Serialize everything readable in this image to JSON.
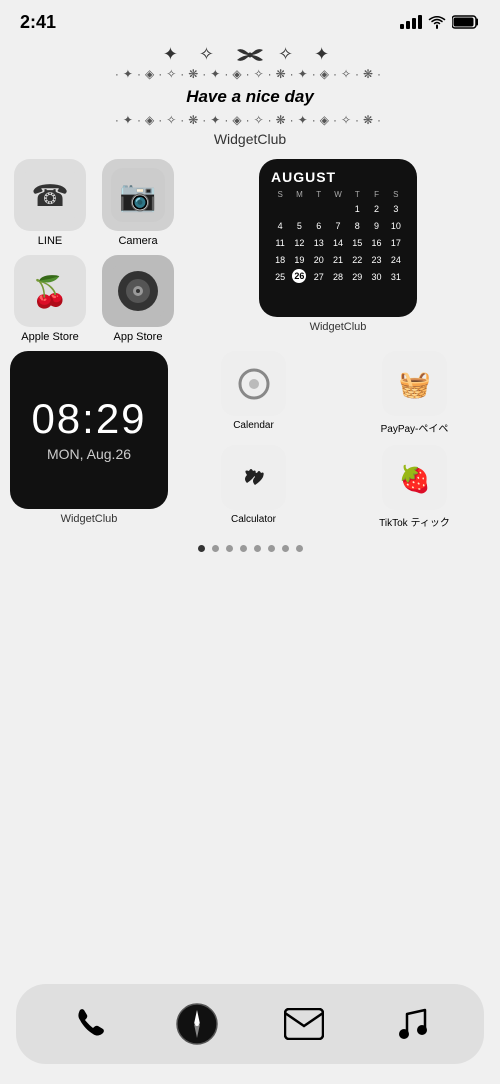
{
  "statusBar": {
    "time": "2:41",
    "battery": "full",
    "wifi": true,
    "signal": true
  },
  "decoration": {
    "bow": "✦ ✧ 𝓑 ✧ ✦",
    "sparkle1": "·✦·✧·❋·✦·✧·❋·✦·",
    "niceDay": "Have a nice day",
    "sparkle2": "·✦·✧·❋·✦·✧·❋·✦·",
    "widgetClubLabel": "WidgetClub"
  },
  "apps": {
    "row1": [
      {
        "name": "LINE",
        "emoji": "📞",
        "bg": "#ddd"
      },
      {
        "name": "Camera",
        "emoji": "📷",
        "bg": "#d5d5d5"
      }
    ],
    "row2": [
      {
        "name": "Apple Store",
        "emoji": "🍒",
        "bg": "#e0e0e0"
      },
      {
        "name": "App Store",
        "emoji": "💿",
        "bg": "#c5c5c5"
      }
    ],
    "calendarWidget": {
      "month": "AUGUST",
      "days": [
        "",
        "",
        "",
        "1",
        "2",
        "3",
        "4",
        "5",
        "6",
        "7",
        "8",
        "9",
        "10",
        "11",
        "12",
        "13",
        "14",
        "15",
        "16",
        "17",
        "18",
        "19",
        "20",
        "21",
        "22",
        "23",
        "24",
        "25",
        "26",
        "27",
        "28",
        "29",
        "30",
        "31"
      ],
      "today": "26",
      "label": "WidgetClub"
    }
  },
  "widgetRow": {
    "clockWidget": {
      "time": "08:29",
      "date": "MON, Aug.26",
      "label": "WidgetClub"
    },
    "smallIcons": [
      {
        "name": "Calendar",
        "emoji": "⭕",
        "bg": "#e8e8e8"
      },
      {
        "name": "PayPay-ペイペ",
        "emoji": "🧺",
        "bg": "#e8e8e8"
      },
      {
        "name": "Calculator",
        "emoji": "🖤",
        "bg": "#e8e8e8"
      },
      {
        "name": "TikTok ティック",
        "emoji": "🍓",
        "bg": "#e8e8e8"
      }
    ]
  },
  "pageDots": {
    "total": 8,
    "active": 0
  },
  "dock": {
    "icons": [
      {
        "name": "phone",
        "symbol": "phone"
      },
      {
        "name": "compass",
        "symbol": "compass"
      },
      {
        "name": "mail",
        "symbol": "mail"
      },
      {
        "name": "music",
        "symbol": "music"
      }
    ]
  }
}
